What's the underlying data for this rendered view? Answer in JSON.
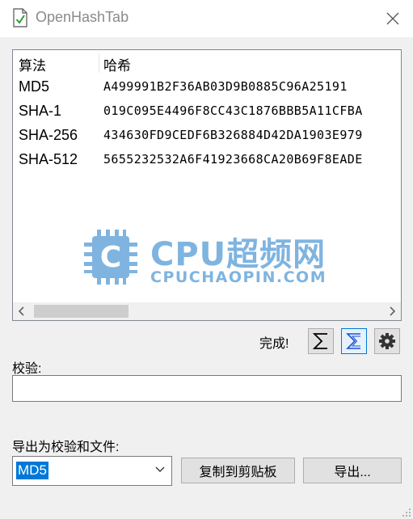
{
  "window": {
    "title": "OpenHashTab"
  },
  "hash_table": {
    "columns": [
      "算法",
      "哈希"
    ],
    "rows": [
      {
        "algorithm": "MD5",
        "hash": "A499991B2F36AB03D9B0885C96A25191"
      },
      {
        "algorithm": "SHA-1",
        "hash": "019C095E4496F8CC43C1876BBB5A11CFBA"
      },
      {
        "algorithm": "SHA-256",
        "hash": "434630FD9CEDF6B326884D42DA1903E979"
      },
      {
        "algorithm": "SHA-512",
        "hash": "5655232532A6F41923668CA20B69F8EADE"
      }
    ]
  },
  "watermark": {
    "title": "CPU超频网",
    "subtitle": "CPUCHAOPIN.COM",
    "logo_letter": "C",
    "color": "#7fb4e0"
  },
  "status": {
    "text": "完成!"
  },
  "toolbar": {
    "icons": [
      "sigma-icon",
      "sigma-outline-icon",
      "gear-icon"
    ]
  },
  "verify": {
    "label": "校验:",
    "value": ""
  },
  "export": {
    "label": "导出为校验和文件:",
    "selected": "MD5",
    "copy_label": "复制到剪贴板",
    "export_label": "导出..."
  },
  "colors": {
    "accent": "#0078d7",
    "window_bg": "#f0f0f0"
  }
}
